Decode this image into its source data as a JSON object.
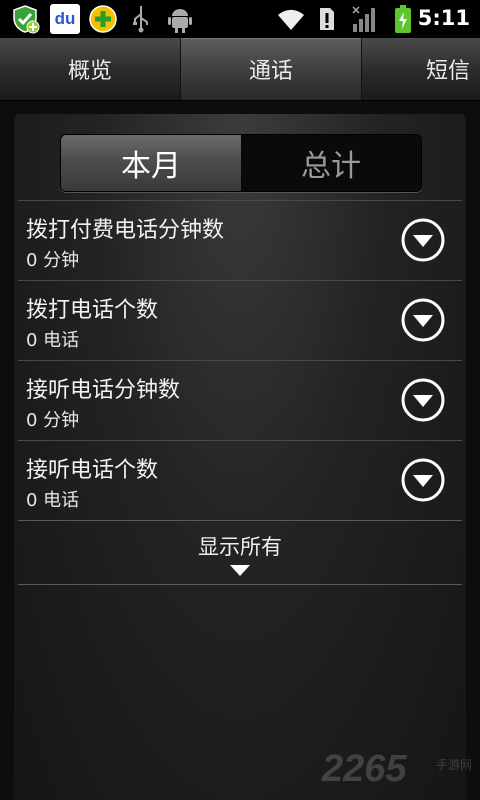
{
  "status_bar": {
    "time": "5:11",
    "icons": [
      "security-shield-icon",
      "baidu-du-icon",
      "plus-app-icon",
      "usb-icon",
      "android-debug-icon",
      "wifi-icon",
      "alert-icon",
      "signal-icon",
      "battery-charging-icon"
    ],
    "du_label": "du"
  },
  "tabs": [
    {
      "label": "概览"
    },
    {
      "label": "通话"
    },
    {
      "label": "短信"
    }
  ],
  "segment": {
    "left": "本月",
    "right": "总计"
  },
  "rows": [
    {
      "title": "拨打付费电话分钟数",
      "value": "0 分钟"
    },
    {
      "title": "拨打电话个数",
      "value": "0 电话"
    },
    {
      "title": "接听电话分钟数",
      "value": "0 分钟"
    },
    {
      "title": "接听电话个数",
      "value": "0 电话"
    }
  ],
  "show_all": "显示所有",
  "watermark": {
    "number": "2265",
    "sub": "手游网"
  },
  "colors": {
    "accent_green": "#5cc52f",
    "background": "#000000"
  }
}
